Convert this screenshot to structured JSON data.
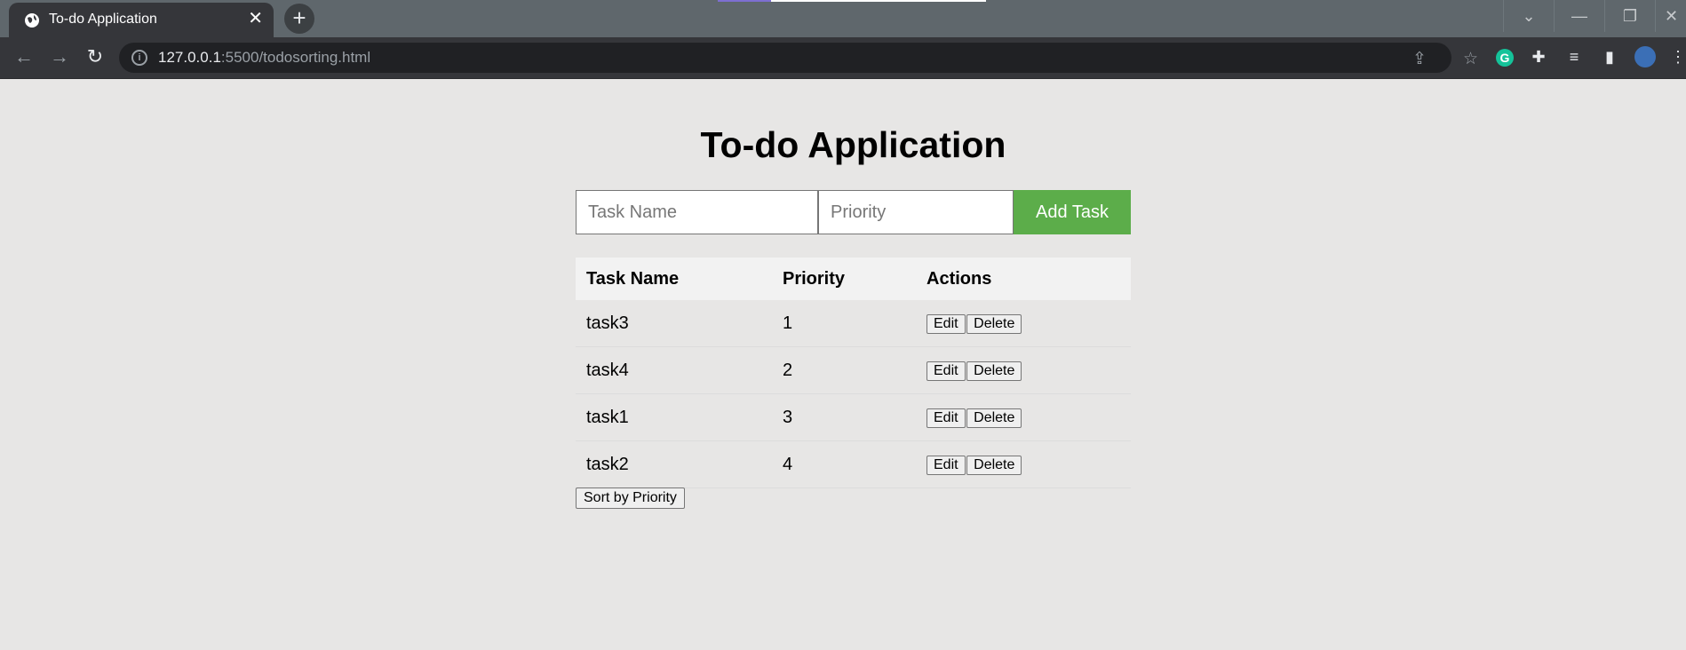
{
  "browser": {
    "tab_title": "To-do Application",
    "url_host": "127.0.0.1",
    "url_rest": ":5500/todosorting.html"
  },
  "app": {
    "title": "To-do Application",
    "task_name_placeholder": "Task Name",
    "priority_placeholder": "Priority",
    "add_label": "Add Task",
    "sort_label": "Sort by Priority",
    "accent_color": "#5cad4a"
  },
  "table": {
    "headers": [
      "Task Name",
      "Priority",
      "Actions"
    ],
    "edit_label": "Edit",
    "delete_label": "Delete",
    "rows": [
      {
        "name": "task3",
        "priority": "1"
      },
      {
        "name": "task4",
        "priority": "2"
      },
      {
        "name": "task1",
        "priority": "3"
      },
      {
        "name": "task2",
        "priority": "4"
      }
    ]
  }
}
